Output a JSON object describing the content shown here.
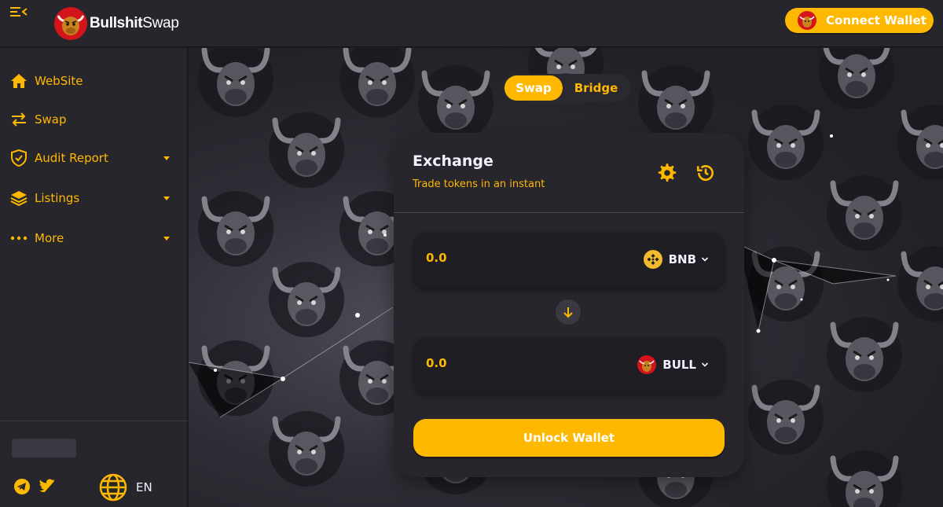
{
  "header": {
    "logo_bold": "Bullshit",
    "logo_light": "Swap",
    "connect_label": "Connect Wallet"
  },
  "sidebar": {
    "items": [
      {
        "label": "WebSite",
        "icon": "home-icon",
        "has_caret": false
      },
      {
        "label": "Swap",
        "icon": "swap-arrows-icon",
        "has_caret": false
      },
      {
        "label": "Audit Report",
        "icon": "shield-check-icon",
        "has_caret": true
      },
      {
        "label": "Listings",
        "icon": "layers-icon",
        "has_caret": true
      },
      {
        "label": "More",
        "icon": "more-dots-icon",
        "has_caret": true
      }
    ],
    "language": "EN"
  },
  "tabs": {
    "swap": "Swap",
    "bridge": "Bridge",
    "active": "swap"
  },
  "exchange": {
    "title": "Exchange",
    "subtitle": "Trade tokens in an instant",
    "from": {
      "amount": "0.0",
      "token": "BNB"
    },
    "to": {
      "amount": "0.0",
      "token": "BULL"
    },
    "unlock_label": "Unlock Wallet"
  },
  "colors": {
    "accent": "#ffb800",
    "panel": "#27262c",
    "input_bg": "#1f1e24",
    "text": "#f4eeff"
  }
}
